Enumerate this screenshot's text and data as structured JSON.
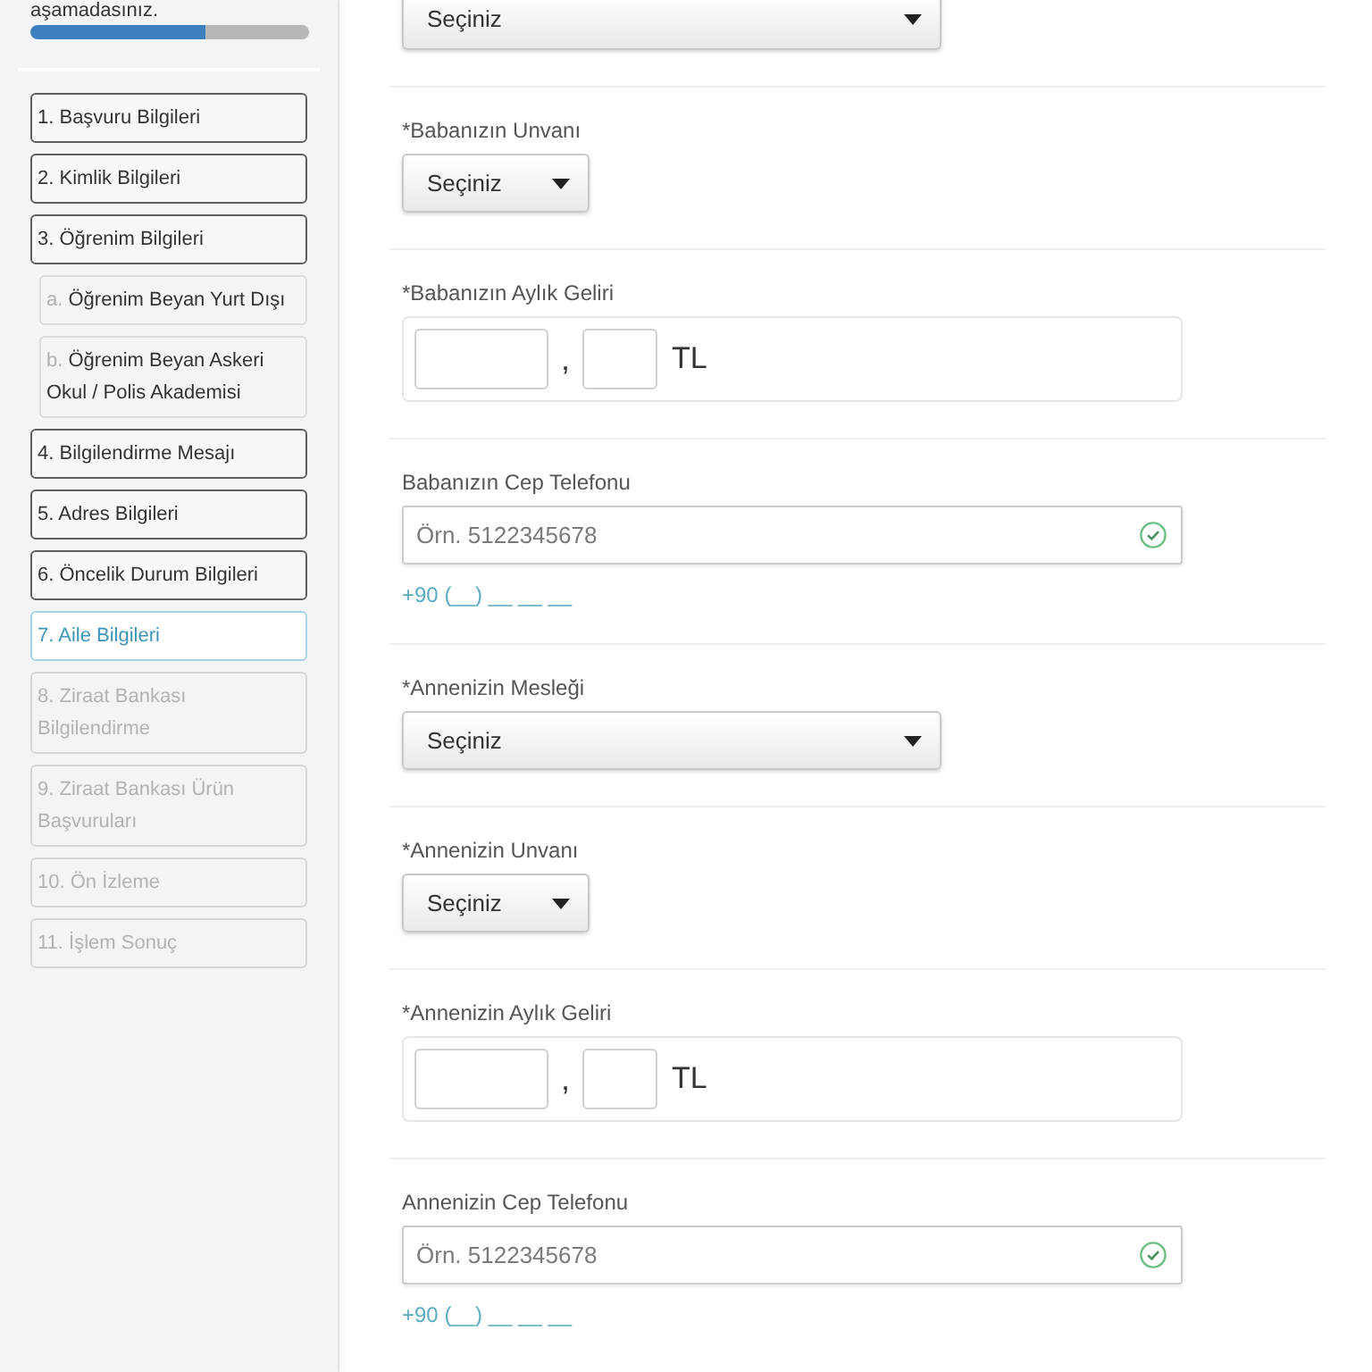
{
  "sidebar": {
    "progress": {
      "caption": "aşamadasınız.",
      "level": 0.63
    },
    "steps": [
      {
        "label": "1. Başvuru Bilgileri",
        "selected": false,
        "disabled": false
      },
      {
        "label": "2. Kimlik Bilgileri",
        "selected": false,
        "disabled": false
      },
      {
        "label": "3. Öğrenim Bilgileri",
        "selected": false,
        "disabled": false,
        "children": [
          {
            "marker": "a.",
            "label": "Öğrenim Beyan Yurt Dışı",
            "selected": false,
            "disabled": false
          },
          {
            "marker": "b.",
            "label": "Öğrenim Beyan Askeri Okul / Polis Akademisi",
            "selected": false,
            "disabled": false
          }
        ]
      },
      {
        "label": "4. Bilgilendirme Mesajı",
        "selected": false,
        "disabled": false
      },
      {
        "label": "5. Adres Bilgileri",
        "selected": false,
        "disabled": false
      },
      {
        "label": "6. Öncelik Durum Bilgileri",
        "selected": false,
        "disabled": false
      },
      {
        "label": "7. Aile Bilgileri",
        "selected": true,
        "disabled": false
      },
      {
        "label": "8. Ziraat Bankası Bilgilendirme",
        "selected": false,
        "disabled": true
      },
      {
        "label": "9. Ziraat Bankası Ürün Başvuruları",
        "selected": false,
        "disabled": true
      },
      {
        "label": "10. Ön İzleme",
        "selected": false,
        "disabled": true
      },
      {
        "label": "11. İşlem Sonuç",
        "selected": false,
        "disabled": true
      }
    ]
  },
  "form": {
    "fields": [
      {
        "kind": "select",
        "value": "Seçiniz"
      },
      {
        "kind": "shortselect",
        "label": "*Babanızın Unvanı",
        "value": "Seçiniz"
      },
      {
        "kind": "amount",
        "label": "*Babanızın Aylık Geliri",
        "separator": ",",
        "currency": "TL"
      },
      {
        "kind": "phone",
        "label": "Babanızın Cep Telefonu",
        "placeholder": "Örn. 5122345678",
        "valid": true,
        "mask": "+90 (__) __ __ __"
      },
      {
        "kind": "select",
        "label": "*Annenizin Mesleği",
        "value": "Seçiniz"
      },
      {
        "kind": "shortselect",
        "label": "*Annenizin Unvanı",
        "value": "Seçiniz"
      },
      {
        "kind": "amount",
        "label": "*Annenizin Aylık Geliri",
        "separator": ",",
        "currency": "TL"
      },
      {
        "kind": "phone",
        "label": "Annenizin Cep Telefonu",
        "placeholder": "Örn. 5122345678",
        "valid": true,
        "mask": "+90 (__) __ __ __"
      }
    ]
  }
}
